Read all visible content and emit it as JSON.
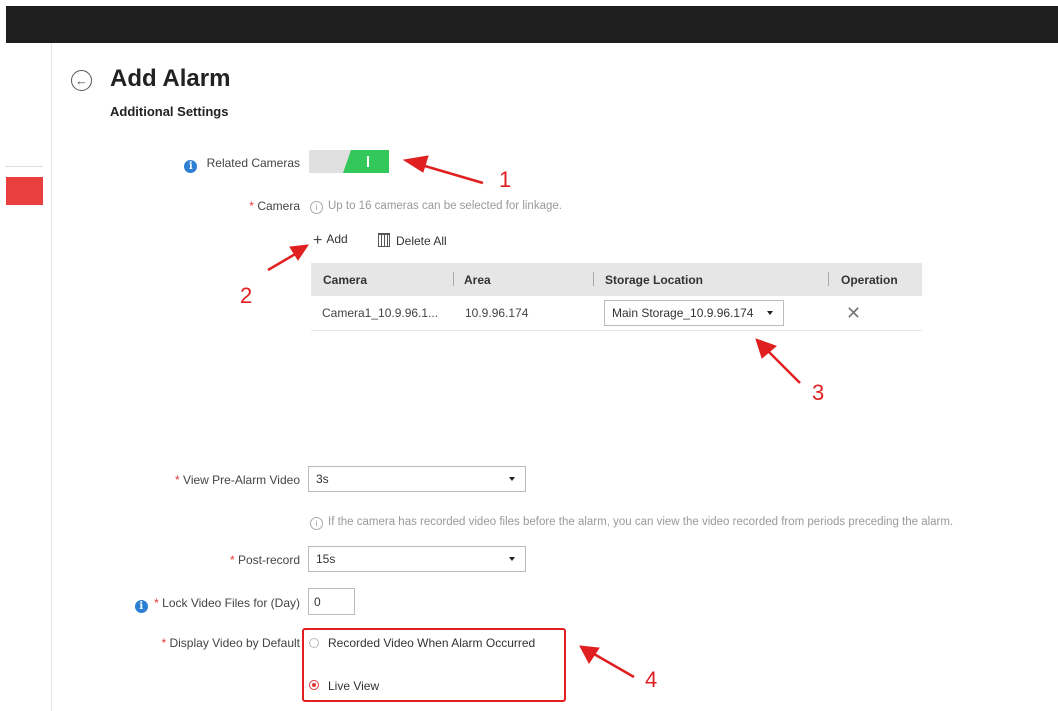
{
  "header": {
    "title": "Add Alarm",
    "subtitle": "Additional Settings"
  },
  "icons": {
    "back": "arrow-left-circle-icon",
    "info": "info-icon",
    "add": "plus-icon",
    "delete": "trash-icon",
    "remove": "close-icon"
  },
  "colors": {
    "accent_red": "#e53935",
    "toggle_on": "#34c759",
    "info_blue": "#2d7fd4"
  },
  "related_cameras": {
    "label": "Related Cameras",
    "enabled": true
  },
  "camera": {
    "label": "Camera",
    "hint": "Up to 16 cameras can be selected for linkage.",
    "add_label": "Add",
    "delete_all_label": "Delete All",
    "table": {
      "headers": [
        "Camera",
        "Area",
        "Storage Location",
        "Operation"
      ],
      "rows": [
        {
          "camera": "Camera1_10.9.96.1...",
          "area": "10.9.96.174",
          "storage": "Main Storage_10.9.96.174"
        }
      ]
    }
  },
  "pre_alarm": {
    "label": "View Pre-Alarm Video",
    "value": "3s",
    "hint": "If the camera has recorded video files before the alarm, you can view the video recorded from periods preceding the alarm."
  },
  "post_record": {
    "label": "Post-record",
    "value": "15s"
  },
  "lock_video": {
    "label": "Lock Video Files for (Day)",
    "value": "0"
  },
  "display_video": {
    "label": "Display Video by Default",
    "options": [
      "Recorded Video When Alarm Occurred",
      "Live View"
    ],
    "selected": "Live View"
  },
  "annotations": [
    "1",
    "2",
    "3",
    "4"
  ]
}
